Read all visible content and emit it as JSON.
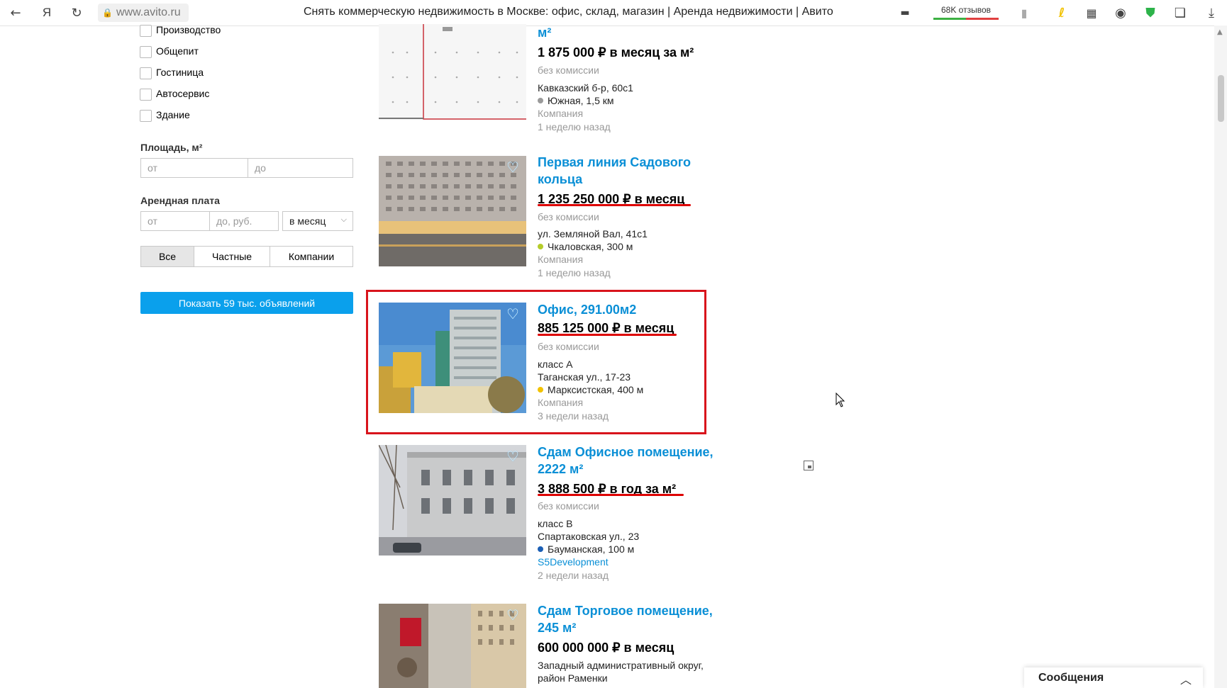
{
  "browser": {
    "url": "www.avito.ru",
    "title": "Снять коммерческую недвижимость в Москве: офис, склад, магазин | Аренда недвижимости | Авито",
    "reviews_label": "68K отзывов",
    "back_icon": "←",
    "yandex_icon": "Я",
    "reload_icon": "↻",
    "lock_icon": "🔒"
  },
  "filters": {
    "types": [
      "Производство",
      "Общепит",
      "Гостиница",
      "Автосервис",
      "Здание"
    ],
    "area_label": "Площадь, м²",
    "area_from_placeholder": "от",
    "area_to_placeholder": "до",
    "rent_label": "Арендная плата",
    "rent_from_placeholder": "от",
    "rent_to_placeholder": "до, руб.",
    "rent_period": "в месяц",
    "seller_tabs": [
      "Все",
      "Частные",
      "Компании"
    ],
    "show_button": "Показать 59 тыс. объявлений"
  },
  "listings": [
    {
      "title": "м²",
      "price": "1 875 000 ₽ в месяц за м²",
      "commission": "без комиссии",
      "address": "Кавказский б-р, 60с1",
      "metro": "Южная, 1,5 км",
      "metro_color": "#9a9a9a",
      "seller": "Компания",
      "date": "1 неделю назад"
    },
    {
      "title_line1": "Первая линия Садового",
      "title_line2": "кольца",
      "price": "1 235 250 000 ₽ в месяц",
      "commission": "без комиссии",
      "address": "ул. Земляной Вал, 41с1",
      "metro": "Чкаловская, 300 м",
      "metro_color": "#b5cc2a",
      "seller": "Компания",
      "date": "1 неделю назад"
    },
    {
      "title": "Офис, 291.00м2",
      "price": "885 125 000 ₽ в месяц",
      "commission": "без комиссии",
      "class": "класс А",
      "address": "Таганская ул., 17-23",
      "metro": "Марксистская, 400 м",
      "metro_color": "#f2c200",
      "seller": "Компания",
      "date": "3 недели назад"
    },
    {
      "title_line1": "Сдам Офисное помещение,",
      "title_line2": "2222 м²",
      "price": "3 888 500 ₽ в год за м²",
      "commission": "без комиссии",
      "class": "класс B",
      "address": "Спартаковская ул., 23",
      "metro": "Бауманская, 100 м",
      "metro_color": "#1b5fb5",
      "seller": "S5Development",
      "date": "2 недели назад"
    },
    {
      "title_line1": "Сдам Торговое помещение,",
      "title_line2": "245 м²",
      "price": "600 000 000 ₽ в месяц",
      "address_line1": "Западный административный округ,",
      "address_line2": "район Раменки"
    }
  ],
  "messages": {
    "label": "Сообщения",
    "chevron": "︿"
  }
}
